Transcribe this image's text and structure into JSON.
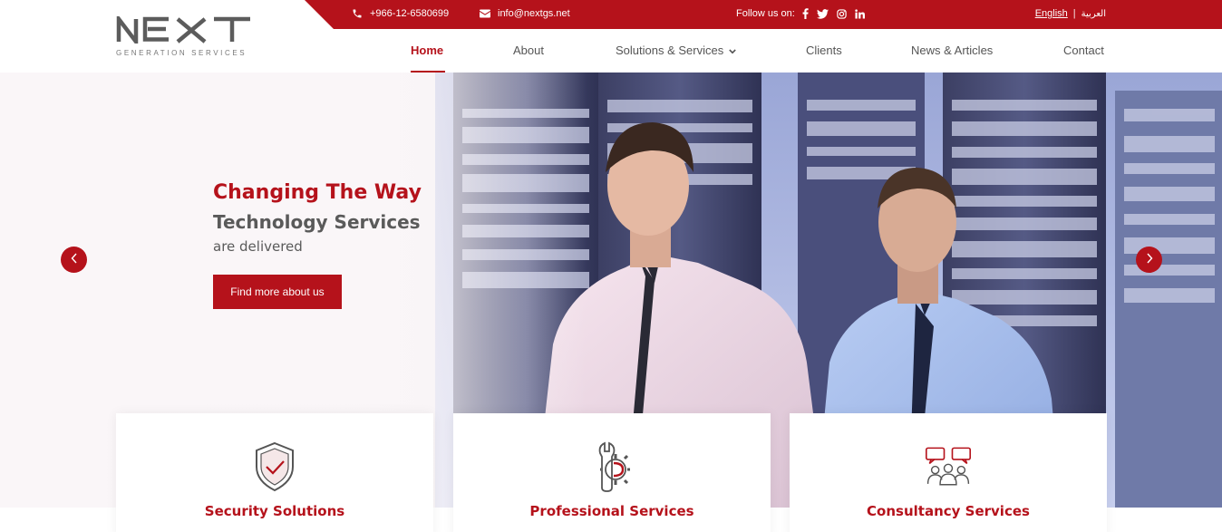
{
  "topbar": {
    "phone": "+966-12-6580699",
    "email": "info@nextgs.net",
    "follow_label": "Follow us on:",
    "social": [
      "facebook-icon",
      "twitter-icon",
      "instagram-icon",
      "linkedin-icon"
    ],
    "lang_en": "English",
    "lang_sep": "|",
    "lang_ar": "العربية"
  },
  "logo": {
    "word": "NEXT",
    "tagline": "GENERATION SERVICES"
  },
  "nav": {
    "items": [
      {
        "label": "Home",
        "active": true
      },
      {
        "label": "About"
      },
      {
        "label": "Solutions & Services",
        "has_dropdown": true
      },
      {
        "label": "Clients"
      },
      {
        "label": "News & Articles"
      },
      {
        "label": "Contact"
      }
    ]
  },
  "hero": {
    "line1": "Changing The Way",
    "line2": "Technology Services",
    "line3": "are delivered",
    "cta": "Find more about us"
  },
  "cards": [
    {
      "title": "Security Solutions",
      "icon": "shield-check-icon"
    },
    {
      "title": "Professional Services",
      "icon": "gear-wrench-icon"
    },
    {
      "title": "Consultancy Services",
      "icon": "people-chat-icon"
    }
  ],
  "colors": {
    "brand_red": "#b5121b",
    "text_gray": "#555555"
  }
}
